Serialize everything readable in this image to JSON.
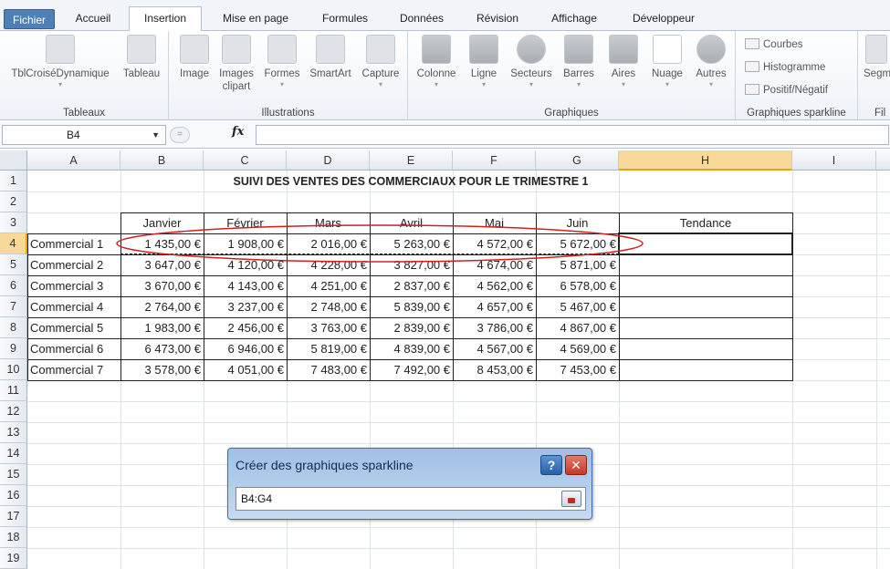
{
  "tabs": [
    "Fichier",
    "Accueil",
    "Insertion",
    "Mise en page",
    "Formules",
    "Données",
    "Révision",
    "Affichage",
    "Développeur"
  ],
  "active_tab": "Insertion",
  "ribbon": {
    "groups": {
      "tableaux": {
        "label": "Tableaux",
        "buttons": [
          "TblCroiséDynamique",
          "Tableau"
        ]
      },
      "illustrations": {
        "label": "Illustrations",
        "buttons": [
          "Image",
          "Images clipart",
          "Formes",
          "SmartArt",
          "Capture"
        ]
      },
      "graphiques": {
        "label": "Graphiques",
        "buttons": [
          "Colonne",
          "Ligne",
          "Secteurs",
          "Barres",
          "Aires",
          "Nuage",
          "Autres"
        ]
      },
      "sparkline": {
        "label": "Graphiques sparkline",
        "items": [
          "Courbes",
          "Histogramme",
          "Positif/Négatif"
        ]
      },
      "next_label": "Fil",
      "next_button": "Segm"
    }
  },
  "formula_bar": {
    "name_box": "B4",
    "fx_label": "fx",
    "formula": ""
  },
  "columns": [
    "A",
    "B",
    "C",
    "D",
    "E",
    "F",
    "G",
    "H",
    "I"
  ],
  "rows": [
    "1",
    "2",
    "3",
    "4",
    "5",
    "6",
    "7",
    "8",
    "9",
    "10",
    "11",
    "12",
    "13",
    "14",
    "15",
    "16",
    "17",
    "18",
    "19"
  ],
  "sheet": {
    "title": "SUIVI DES VENTES DES COMMERCIAUX POUR LE TRIMESTRE 1",
    "headers": [
      "Janvier",
      "Février",
      "Mars",
      "Avril",
      "Mai",
      "Juin",
      "Tendance"
    ],
    "data": [
      {
        "name": "Commercial 1",
        "values": [
          "1 435,00 €",
          "1 908,00 €",
          "2 016,00 €",
          "5 263,00 €",
          "4 572,00 €",
          "5 672,00 €"
        ]
      },
      {
        "name": "Commercial 2",
        "values": [
          "3 647,00 €",
          "4 120,00 €",
          "4 228,00 €",
          "3 827,00 €",
          "4 674,00 €",
          "5 871,00 €"
        ]
      },
      {
        "name": "Commercial 3",
        "values": [
          "3 670,00 €",
          "4 143,00 €",
          "4 251,00 €",
          "2 837,00 €",
          "4 562,00 €",
          "6 578,00 €"
        ]
      },
      {
        "name": "Commercial 4",
        "values": [
          "2 764,00 €",
          "3 237,00 €",
          "2 748,00 €",
          "5 839,00 €",
          "4 657,00 €",
          "5 467,00 €"
        ]
      },
      {
        "name": "Commercial 5",
        "values": [
          "1 983,00 €",
          "2 456,00 €",
          "3 763,00 €",
          "2 839,00 €",
          "3 786,00 €",
          "4 867,00 €"
        ]
      },
      {
        "name": "Commercial 6",
        "values": [
          "6 473,00 €",
          "6 946,00 €",
          "5 819,00 €",
          "4 839,00 €",
          "4 567,00 €",
          "4 569,00 €"
        ]
      },
      {
        "name": "Commercial 7",
        "values": [
          "3 578,00 €",
          "4 051,00 €",
          "7 483,00 €",
          "7 492,00 €",
          "8 453,00 €",
          "7 453,00 €"
        ]
      }
    ]
  },
  "selected_cell": "B4",
  "dialog": {
    "title": "Créer des graphiques sparkline",
    "help_label": "?",
    "close_label": "✕",
    "range_value": "B4:G4"
  },
  "colors": {
    "selection_header": "#f9d99a",
    "ellipse": "#d22020",
    "file_tab": "#4f7fb7"
  }
}
